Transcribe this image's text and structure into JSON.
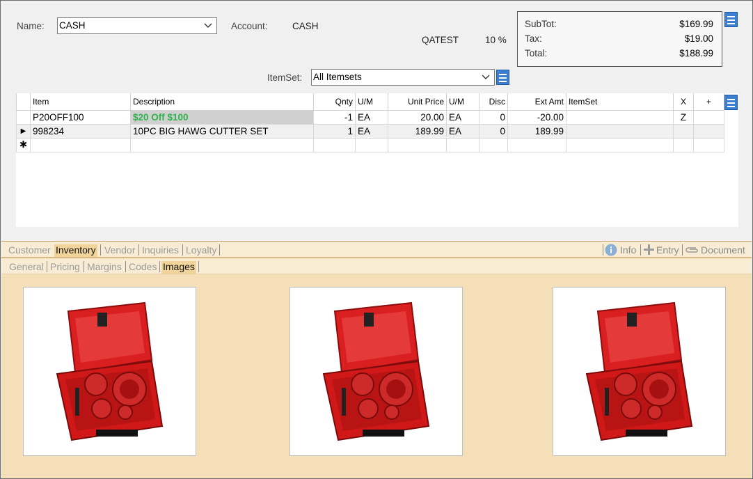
{
  "header": {
    "name_label": "Name:",
    "name_value": "CASH",
    "account_label": "Account:",
    "account_value": "CASH",
    "price_level": "QATEST",
    "percent": "10 %",
    "itemset_label": "ItemSet:",
    "itemset_value": "All Itemsets"
  },
  "totals": {
    "subtot_label": "SubTot:",
    "subtot_value": "$169.99",
    "tax_label": "Tax:",
    "tax_value": "$19.00",
    "total_label": "Total:",
    "total_value": "$188.99"
  },
  "grid": {
    "columns": [
      "Item",
      "Description",
      "Qnty",
      "U/M",
      "Unit Price",
      "U/M",
      "Disc",
      "Ext Amt",
      "ItemSet",
      "X",
      "+"
    ],
    "rows": [
      {
        "marker": "",
        "item": "P20OFF100",
        "description": "$20 Off $100",
        "qnty": "-1",
        "um": "EA",
        "unit_price": "20.00",
        "um2": "EA",
        "disc": "0",
        "ext_amt": "-20.00",
        "itemset": "",
        "x": "Z",
        "plus": ""
      },
      {
        "marker": "▶",
        "item": "998234",
        "description": "10PC BIG HAWG CUTTER SET",
        "qnty": "1",
        "um": "EA",
        "unit_price": "189.99",
        "um2": "EA",
        "disc": "0",
        "ext_amt": "189.99",
        "itemset": "",
        "x": "",
        "plus": ""
      },
      {
        "marker": "✱",
        "item": "",
        "description": "",
        "qnty": "",
        "um": "",
        "unit_price": "",
        "um2": "",
        "disc": "",
        "ext_amt": "",
        "itemset": "",
        "x": "",
        "plus": ""
      }
    ]
  },
  "tabs_primary": [
    "Customer",
    "Inventory",
    "Vendor",
    "Inquiries",
    "Loyalty"
  ],
  "tabs_primary_active": "Inventory",
  "toolbar": {
    "info_label": "Info",
    "entry_label": "Entry",
    "document_label": "Document"
  },
  "tabs_secondary": [
    "General",
    "Pricing",
    "Margins",
    "Codes",
    "Images"
  ],
  "tabs_secondary_active": "Images",
  "images": [
    {
      "icon": "hole-saw-kit-image"
    },
    {
      "icon": "hole-saw-kit-image"
    },
    {
      "icon": "hole-saw-kit-image"
    }
  ],
  "colors": {
    "accent_blue": "#3b7fd0",
    "promo_green": "#2db34a",
    "panel_tan": "#f5dfb8"
  }
}
